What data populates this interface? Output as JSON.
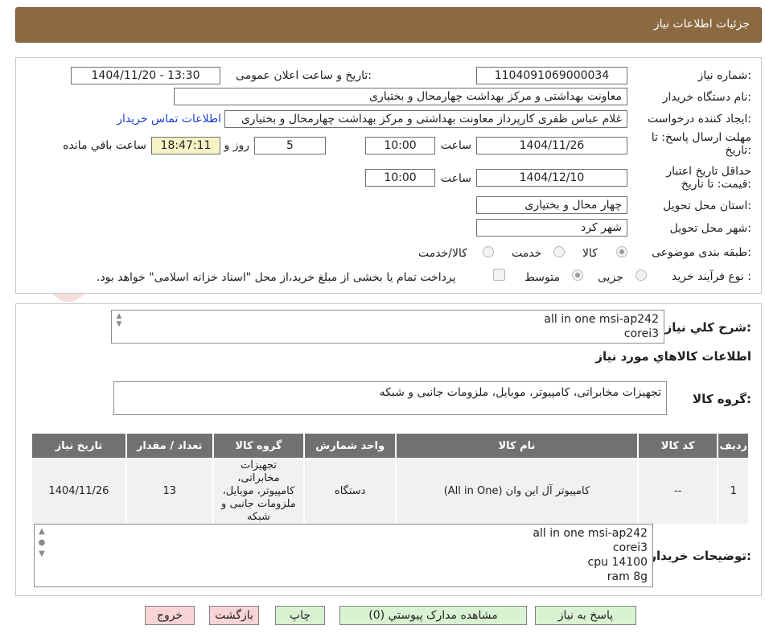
{
  "header": {
    "title": "جزئیات اطلاعات نیاز"
  },
  "form": {
    "need_number_label": "شماره نیاز:",
    "need_number": "1104091069000034",
    "announce_label": "تاریخ و ساعت اعلان عمومی:",
    "announce_value": "1404/11/20 - 13:30",
    "buyer_org_label": "نام دستگاه خریدار:",
    "buyer_org": "معاونت  بهداشتی  و مرکز بهداشت چهارمحال و بختیاری",
    "creator_label": "ایجاد کننده درخواست:",
    "creator": "غلام عباس ظفری کارپرداز معاونت  بهداشتی  و مرکز بهداشت چهارمحال و بختیاری",
    "contact_link": "اطلاعات تماس خریدار",
    "reply_deadline_label_1": "مهلت ارسال پاسخ: تا",
    "reply_deadline_label_2": "تاریخ:",
    "reply_date": "1404/11/26",
    "time_label": "ساعت",
    "reply_time": "10:00",
    "days_value": "5",
    "days_label": "روز و",
    "remaining_time": "18:47:11",
    "remaining_label": "ساعت باقي مانده",
    "validity_label_1": "حداقل تاریخ اعتبار",
    "validity_label_2": "قیمت: تا تاریخ:",
    "validity_date": "1404/12/10",
    "validity_time": "10:00",
    "province_label": "استان محل تحویل:",
    "province": "چهار محال و بختیاری",
    "city_label": "شهر محل تحویل:",
    "city": "شهر کرد",
    "category_label": "طبقه بندی موضوعی:",
    "category_options": [
      "کالا",
      "خدمت",
      "کالا/خدمت"
    ],
    "process_label": "نوع فرآیند خرید :",
    "process_options": [
      "جزیی",
      "متوسط"
    ],
    "payment_note": "پرداخت تمام یا بخشی از مبلغ خرید،از محل \"اسناد خزانه اسلامی\" خواهد بود."
  },
  "summary": {
    "label": "شرح کلي نياز:",
    "lines": [
      "all in one msi-ap242",
      "corei3"
    ]
  },
  "goods": {
    "section_title": "اطلاعات کالاهاي مورد نياز",
    "group_label": "گروه کالا:",
    "group_value": "تجهیزات مخابراتی، کامپیوتر، موبایل، ملزومات جانبی و شبکه"
  },
  "table": {
    "headers": [
      "رديف",
      "کد کالا",
      "نام کالا",
      "واحد شمارش",
      "گروه کالا",
      "تعداد / مقدار",
      "تاريخ نياز"
    ],
    "rows": [
      {
        "row": "1",
        "code": "--",
        "name": "کامپیوتر آل این وان (All in One)",
        "unit": "دستگاه",
        "group": "تجهیزات مخابراتی، کامپیوتر، موبایل، ملزومات جانبی و شبکه",
        "qty": "13",
        "date": "1404/11/26"
      }
    ]
  },
  "buyer_notes": {
    "label": "توضيحات خريدار:",
    "lines": [
      "all in one msi-ap242",
      "corei3",
      "cpu 14100",
      "ram 8g"
    ]
  },
  "buttons": {
    "reply": "پاسخ به نیاز",
    "attachments": "مشاهده مدارک پیوستي (0)",
    "print": "چاپ",
    "back": "بازگشت",
    "exit": "خروج"
  },
  "watermark": {
    "text": "AriaTender.neT"
  },
  "colors": {
    "header_bg": "#8b6a42",
    "link": "#1f3fd0",
    "table_header": "#717171",
    "button_green": "#d9f2d2",
    "button_pink": "#f9d4d6"
  }
}
